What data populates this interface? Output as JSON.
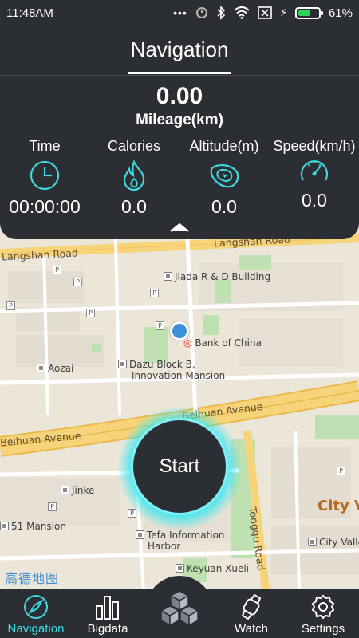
{
  "status_bar": {
    "time": "11:48AM",
    "battery_percent_label": "61%",
    "battery_level": 0.61
  },
  "header": {
    "title": "Navigation"
  },
  "summary": {
    "mileage_value": "0.00",
    "mileage_label": "Mileage(km)"
  },
  "stats": [
    {
      "label": "Time",
      "value": "00:00:00",
      "icon": "clock-icon"
    },
    {
      "label": "Calories",
      "value": "0.0",
      "icon": "flame-icon"
    },
    {
      "label": "Altitude(m)",
      "value": "0.0",
      "icon": "altitude-icon"
    },
    {
      "label": "Speed(km/h)",
      "value": "0.0",
      "icon": "speedometer-icon"
    }
  ],
  "map": {
    "logo": "高德地图",
    "labels": {
      "langshan_road_left": "Langshan Road",
      "langshan_road_right": "Langshan Road",
      "jiada": "Jiada R & D Building",
      "bank": "Bank of China",
      "aozai": "Aozai",
      "dazu_line1": "Dazu Block B,",
      "dazu_line2": "Innovation Mansion",
      "beihuan_right": "Beihuan Avenue",
      "beihuan_left": "Beihuan Avenue",
      "jinke": "Jinke",
      "mansion51": "51 Mansion",
      "tefa_line1": "Tefa Information",
      "tefa_line2": "Harbor",
      "keyuan": "Keyuan Xueli",
      "tonggu": "Tonggu Road",
      "city_v": "City V",
      "city_valley": "City Valle"
    }
  },
  "start_button": {
    "label": "Start"
  },
  "bottom_nav": {
    "items": [
      {
        "label": "Navigation",
        "icon": "compass-icon",
        "active": true
      },
      {
        "label": "Bigdata",
        "icon": "bar-chart-icon",
        "active": false
      },
      {
        "label": "Watch",
        "icon": "watch-icon",
        "active": false
      },
      {
        "label": "Settings",
        "icon": "gear-icon",
        "active": false
      }
    ],
    "center_icon": "cube-logo-icon"
  },
  "colors": {
    "panel_bg": "#2b2e32",
    "accent": "#3fd8e0",
    "battery_green": "#2fd15a",
    "location_blue": "#3d8fd8"
  }
}
